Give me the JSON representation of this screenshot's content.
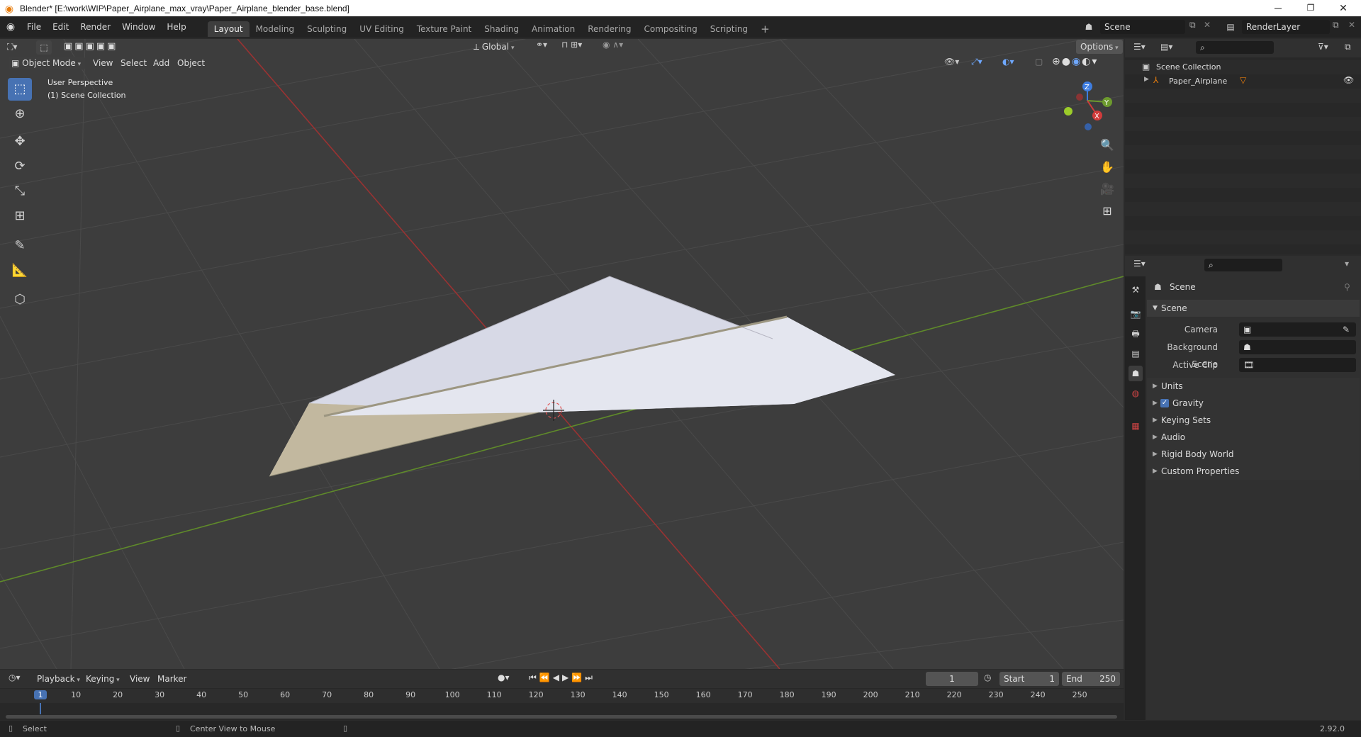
{
  "window": {
    "title": "Blender* [E:\\work\\WIP\\Paper_Airplane_max_vray\\Paper_Airplane_blender_base.blend]",
    "minimize": "─",
    "restore": "❐",
    "close": "✕"
  },
  "menus": [
    "File",
    "Edit",
    "Render",
    "Window",
    "Help"
  ],
  "workspaces": [
    "Layout",
    "Modeling",
    "Sculpting",
    "UV Editing",
    "Texture Paint",
    "Shading",
    "Animation",
    "Rendering",
    "Compositing",
    "Scripting"
  ],
  "add_workspace": "+",
  "scene_field": "Scene",
  "view_layer_field": "RenderLayer",
  "viewport": {
    "mode": "Object Mode",
    "menu": [
      "View",
      "Select",
      "Add",
      "Object"
    ],
    "transform_orientation": "Global",
    "options": "Options",
    "overlay_line1": "User Perspective",
    "overlay_line2": "(1) Scene Collection",
    "gizmo": {
      "z": "Z",
      "y": "Y",
      "x": "X"
    }
  },
  "outliner": {
    "root": "Scene Collection",
    "items": [
      {
        "name": "Paper_Airplane"
      }
    ]
  },
  "properties": {
    "context": "Scene",
    "panel": "Scene",
    "fields": [
      {
        "label": "Camera",
        "value": ""
      },
      {
        "label": "Background Scene",
        "value": ""
      },
      {
        "label": "Active Clip",
        "value": ""
      }
    ],
    "sections": [
      "Units",
      "Gravity",
      "Keying Sets",
      "Audio",
      "Rigid Body World",
      "Custom Properties"
    ],
    "gravity_checked": true
  },
  "timeline": {
    "menu": [
      "Playback",
      "Keying",
      "View",
      "Marker"
    ],
    "current_frame": "1",
    "start_label": "Start",
    "start": "1",
    "end_label": "End",
    "end": "250",
    "ticks": [
      "1",
      "10",
      "20",
      "30",
      "40",
      "50",
      "60",
      "70",
      "80",
      "90",
      "100",
      "110",
      "120",
      "130",
      "140",
      "150",
      "160",
      "170",
      "180",
      "190",
      "200",
      "210",
      "220",
      "230",
      "240",
      "250"
    ]
  },
  "status": {
    "left": "Select",
    "middle": "Center View to Mouse",
    "version": "2.92.0"
  },
  "colors": {
    "accent": "#4772b3",
    "x_axis": "#d13b3b",
    "y_axis": "#6d9a2e",
    "z_axis": "#3e7de0",
    "object_orange": "#e87d0d"
  }
}
